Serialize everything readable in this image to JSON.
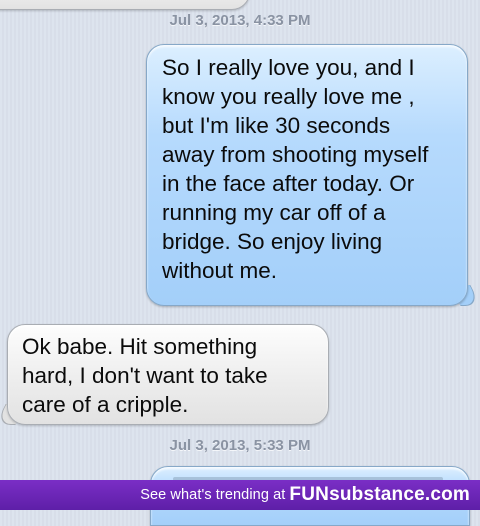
{
  "conversation": {
    "timestamps": [
      "Jul 3, 2013, 4:33 PM",
      "Jul 3, 2013, 5:33 PM"
    ],
    "messages": [
      {
        "direction": "sent",
        "text": "So I really love you, and I\nknow you really love me ,\nbut I'm like 30 seconds\naway from shooting myself\nin the face after today. Or\nrunning my car off of a\nbridge. So enjoy living\nwithout me."
      },
      {
        "direction": "received",
        "text": "Ok babe. Hit something\nhard, I don't want to take\ncare of a cripple."
      }
    ]
  },
  "footer": {
    "text": "See what's trending at",
    "brand": "FUNsubstance.com"
  },
  "colors": {
    "sent_bubble": "#a3cff9",
    "received_bubble": "#e6e6e6",
    "footer_bar": "#6a24b8"
  }
}
